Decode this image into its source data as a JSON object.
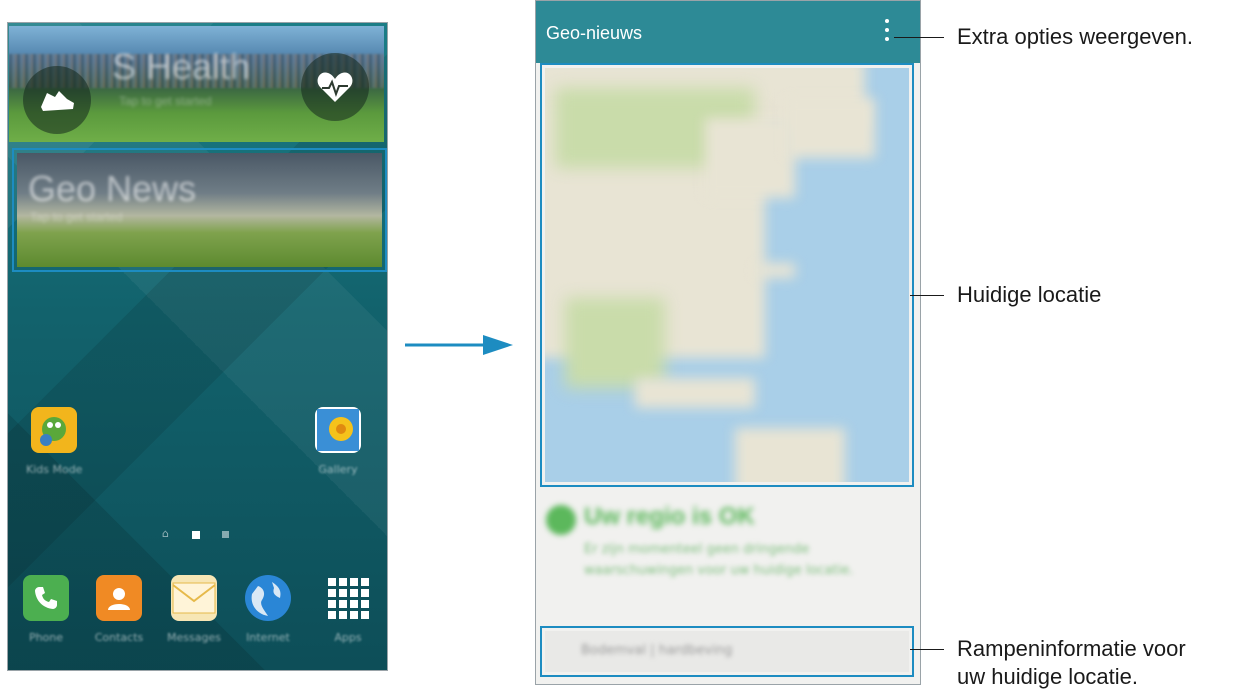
{
  "left_phone": {
    "shealth_card": {
      "title": "S Health",
      "subtitle": "Tap to get started"
    },
    "geo_card": {
      "title": "Geo News",
      "subtitle": "Tap to get started"
    },
    "apps": [
      {
        "label": "Kids Mode",
        "icon": "kids-mode-icon"
      },
      {
        "label": "Gallery",
        "icon": "gallery-icon"
      }
    ],
    "dock": [
      {
        "label": "Phone",
        "icon": "phone-icon",
        "color": "#4caf50"
      },
      {
        "label": "Contacts",
        "icon": "contacts-icon",
        "color": "#f08a24"
      },
      {
        "label": "Messages",
        "icon": "messages-icon",
        "color": "#f5c542"
      },
      {
        "label": "Internet",
        "icon": "globe-icon",
        "color": "#2a86d6"
      },
      {
        "label": "Apps",
        "icon": "apps-grid-icon",
        "color": "#ffffff"
      }
    ]
  },
  "right_phone": {
    "app_title": "Geo-nieuws",
    "status": {
      "title": "Uw regio is OK",
      "text": "Er zijn momenteel geen dringende waarschuwingen voor uw huidige locatie."
    },
    "disaster_label": "Bodemval | hardbeving"
  },
  "callouts": {
    "options": "Extra opties weergeven.",
    "location": "Huidige locatie",
    "disaster_line1": "Rampeninformatie voor",
    "disaster_line2": "uw huidige locatie."
  },
  "colors": {
    "accent": "#1d8cc1",
    "appbar": "#2d8a96",
    "status_ok": "#5cb85c"
  }
}
